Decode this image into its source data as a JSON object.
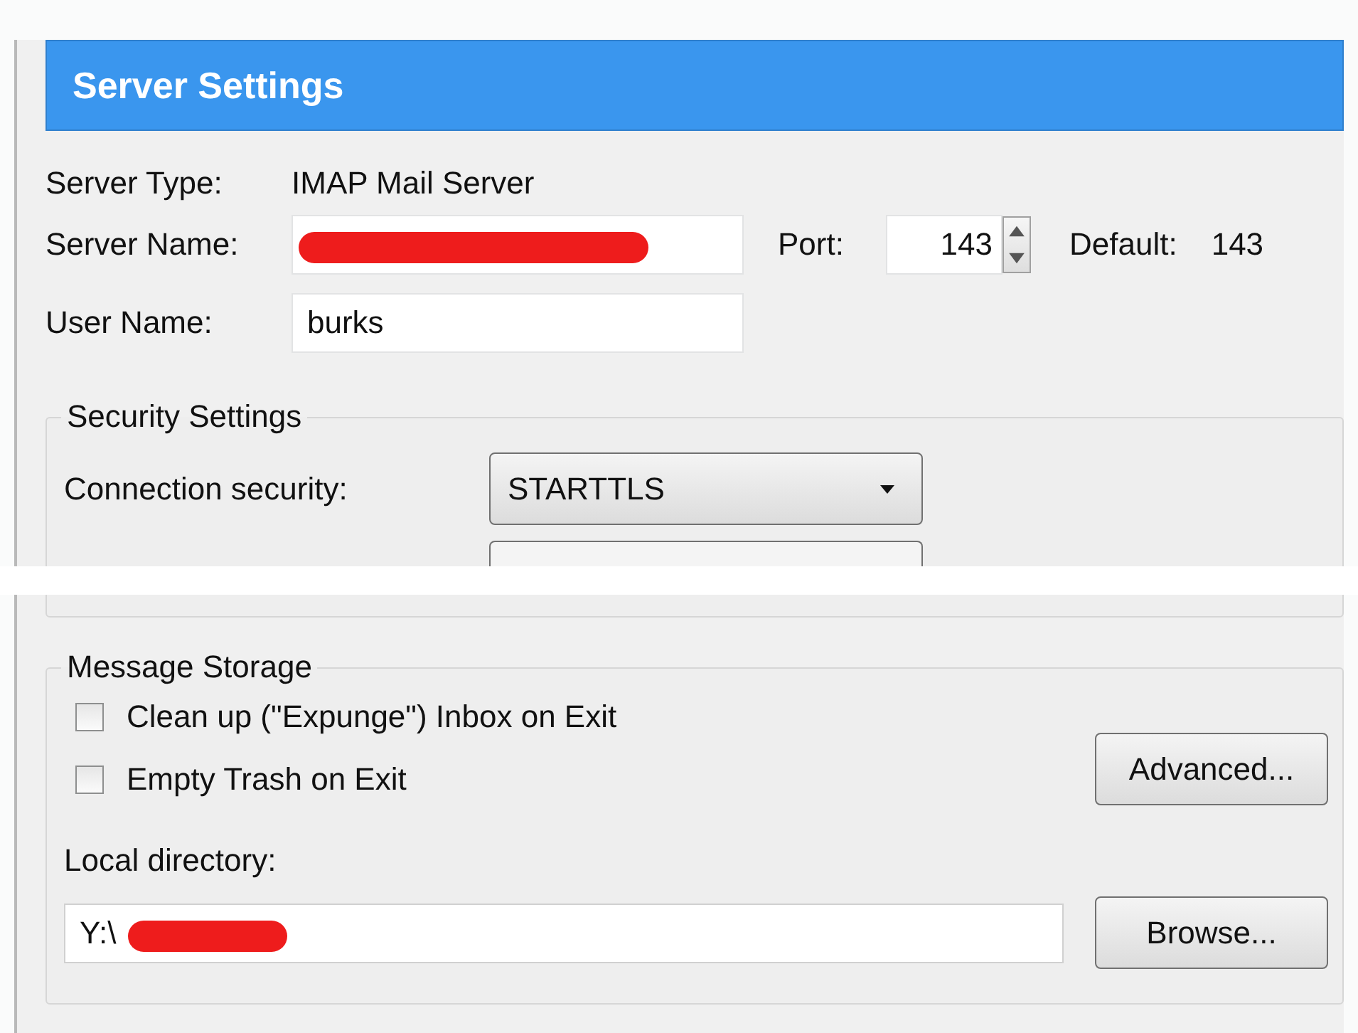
{
  "header": {
    "title": "Server Settings"
  },
  "server_type": {
    "label": "Server Type:",
    "value": "IMAP Mail Server"
  },
  "server_name": {
    "label": "Server Name:",
    "redacted": true
  },
  "port": {
    "label": "Port:",
    "value": "143"
  },
  "default_port": {
    "label": "Default:",
    "value": "143"
  },
  "user_name": {
    "label": "User Name:",
    "value": "burks"
  },
  "security": {
    "legend": "Security Settings",
    "connection_label": "Connection security:",
    "connection_value": "STARTTLS"
  },
  "storage": {
    "legend": "Message Storage",
    "options": [
      {
        "label": "Clean up (\"Expunge\") Inbox on Exit",
        "checked": false
      },
      {
        "label": "Empty Trash on Exit",
        "checked": false
      }
    ],
    "advanced_button": "Advanced...",
    "directory_label": "Local directory:",
    "directory_value": "Y:\\",
    "directory_redacted": true,
    "browse_button": "Browse..."
  }
}
